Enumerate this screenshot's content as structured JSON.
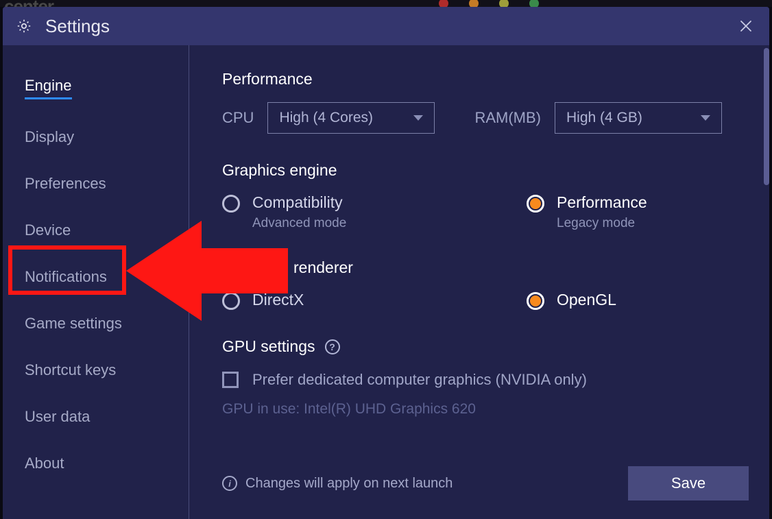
{
  "background": {
    "word": "center"
  },
  "titlebar": {
    "title": "Settings"
  },
  "sidebar": {
    "items": [
      {
        "label": "Engine",
        "name": "sidebar-item-engine",
        "active": true
      },
      {
        "label": "Display",
        "name": "sidebar-item-display",
        "active": false
      },
      {
        "label": "Preferences",
        "name": "sidebar-item-preferences",
        "active": false
      },
      {
        "label": "Device",
        "name": "sidebar-item-device",
        "active": false
      },
      {
        "label": "Notifications",
        "name": "sidebar-item-notifications",
        "active": false
      },
      {
        "label": "Game settings",
        "name": "sidebar-item-game-settings",
        "active": false
      },
      {
        "label": "Shortcut keys",
        "name": "sidebar-item-shortcut-keys",
        "active": false
      },
      {
        "label": "User data",
        "name": "sidebar-item-user-data",
        "active": false
      },
      {
        "label": "About",
        "name": "sidebar-item-about",
        "active": false
      }
    ]
  },
  "engine": {
    "performance": {
      "title": "Performance",
      "cpu_label": "CPU",
      "cpu_value": "High (4 Cores)",
      "ram_label": "RAM(MB)",
      "ram_value": "High (4 GB)"
    },
    "graphics": {
      "title": "Graphics engine",
      "options": [
        {
          "title": "Compatibility",
          "sub": "Advanced mode",
          "selected": false
        },
        {
          "title": "Performance",
          "sub": "Legacy mode",
          "selected": true
        }
      ]
    },
    "renderer": {
      "title_fragment": "renderer",
      "options": [
        {
          "title": "DirectX",
          "selected": false
        },
        {
          "title": "OpenGL",
          "selected": true
        }
      ]
    },
    "gpu": {
      "title": "GPU settings",
      "checkbox_label": "Prefer dedicated computer graphics (NVIDIA only)",
      "in_use": "GPU in use: Intel(R) UHD Graphics 620"
    },
    "footer": {
      "info": "Changes will apply on next launch",
      "save": "Save"
    }
  },
  "annotation": {
    "target_sidebar_item": "Notifications"
  }
}
